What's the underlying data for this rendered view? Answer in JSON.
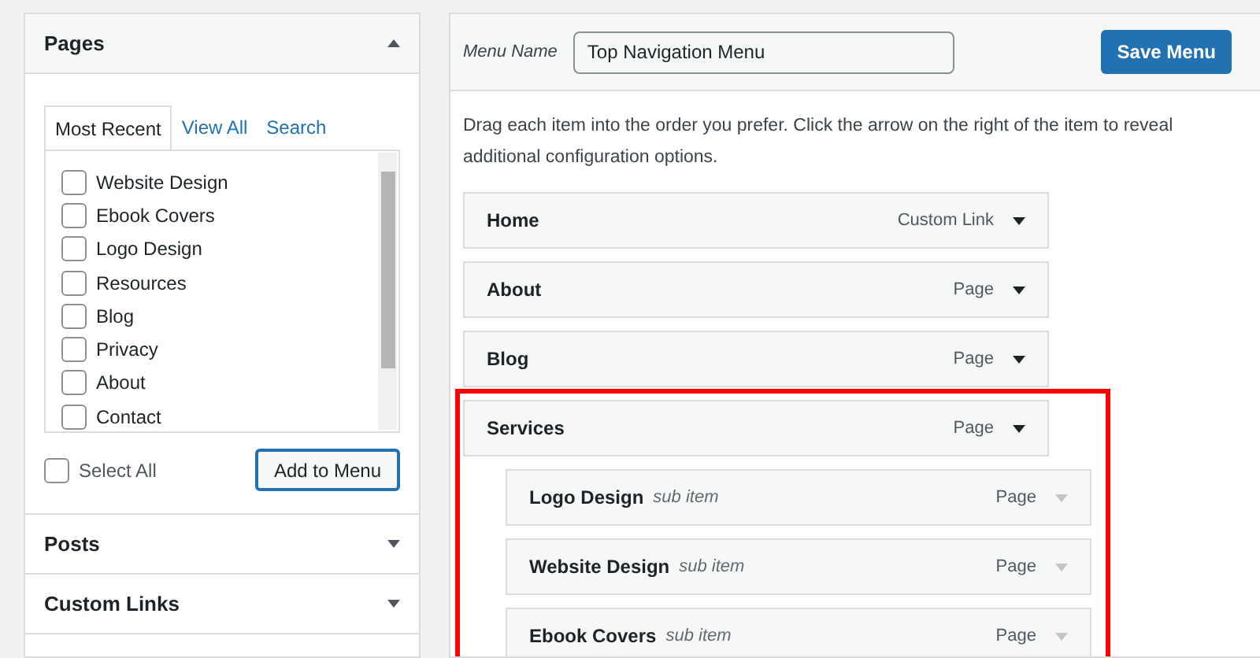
{
  "add_items": {
    "sections": [
      {
        "title": "Pages",
        "expanded": true
      },
      {
        "title": "Posts",
        "expanded": false
      },
      {
        "title": "Custom Links",
        "expanded": false
      }
    ],
    "tabs": [
      {
        "label": "Most Recent",
        "selected": true
      },
      {
        "label": "View All",
        "selected": false
      },
      {
        "label": "Search",
        "selected": false
      }
    ],
    "pages": [
      {
        "label": "Website Design",
        "checked": false
      },
      {
        "label": "Ebook Covers",
        "checked": false
      },
      {
        "label": "Logo Design",
        "checked": false
      },
      {
        "label": "Resources",
        "checked": false
      },
      {
        "label": "Blog",
        "checked": false
      },
      {
        "label": "Privacy",
        "checked": false
      },
      {
        "label": "About",
        "checked": false
      },
      {
        "label": "Contact",
        "checked": false
      }
    ],
    "select_all": {
      "label": "Select All",
      "checked": false
    },
    "add_button": "Add to Menu"
  },
  "menu": {
    "name_label": "Menu Name",
    "name_value": "Top Navigation Menu",
    "save_button": "Save Menu",
    "instructions": "Drag each item into the order you prefer. Click the arrow on the right of the item to reveal additional configuration options.",
    "items": [
      {
        "title": "Home",
        "type": "Custom Link"
      },
      {
        "title": "About",
        "type": "Page"
      },
      {
        "title": "Blog",
        "type": "Page"
      },
      {
        "title": "Services",
        "type": "Page",
        "highlighted": true,
        "children": [
          {
            "title": "Logo Design",
            "note": "sub item",
            "type": "Page"
          },
          {
            "title": "Website Design",
            "note": "sub item",
            "type": "Page"
          },
          {
            "title": "Ebook Covers",
            "note": "sub item",
            "type": "Page"
          }
        ]
      }
    ]
  }
}
